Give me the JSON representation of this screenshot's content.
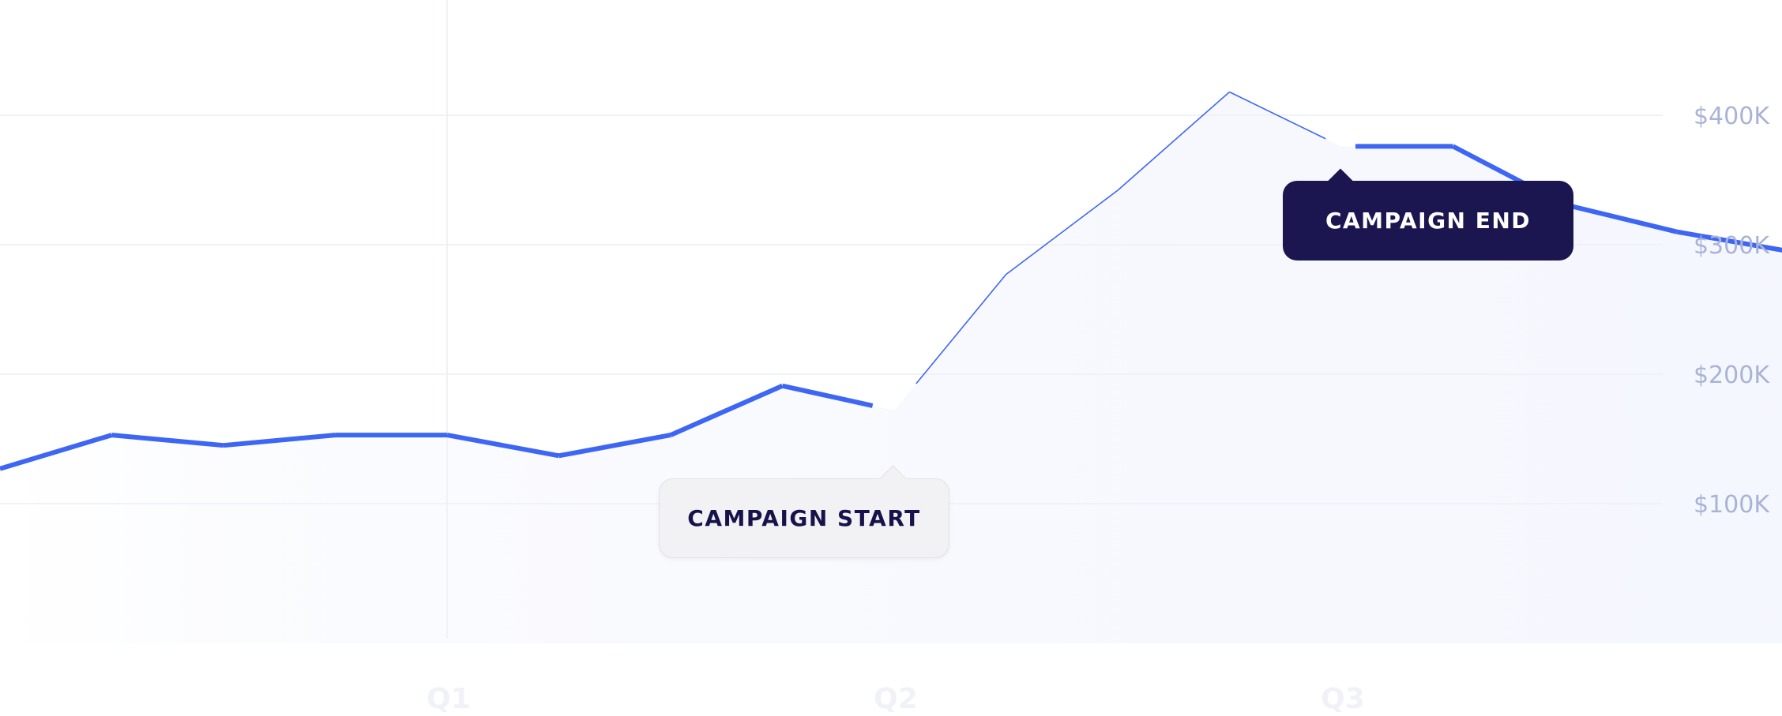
{
  "chart_data": {
    "type": "line",
    "title": "",
    "xlabel": "",
    "ylabel": "",
    "quarters": [
      "Q1",
      "Q2",
      "Q3"
    ],
    "y_ticks": [
      {
        "value": 100000,
        "label": "$100K"
      },
      {
        "value": 200000,
        "label": "$200K"
      },
      {
        "value": 300000,
        "label": "$300K"
      },
      {
        "value": 400000,
        "label": "$400K"
      }
    ],
    "ylim": [
      -4000,
      488000
    ],
    "xlim": [
      0,
      16
    ],
    "series": [
      {
        "color": "#3d66f5",
        "x": [
          0,
          1,
          2,
          3,
          4,
          5,
          6,
          7,
          8,
          9,
          10,
          11,
          12,
          13,
          14,
          15,
          16
        ],
        "values": [
          127000,
          153000,
          145000,
          153000,
          153000,
          137000,
          153000,
          191000,
          172000,
          277000,
          342000,
          418000,
          376000,
          376000,
          331000,
          310000,
          295000
        ]
      }
    ],
    "grid": true,
    "annotations": [
      {
        "label": "CAMPAIGN START",
        "style": "light",
        "x": 8
      },
      {
        "label": "CAMPAIGN END",
        "style": "dark",
        "x": 12
      }
    ],
    "colors": {
      "line": "#3d66f5",
      "area": "#eef1fd",
      "grid": "#eceef5",
      "tick_label": "#aab3d6",
      "quarter_label": "#f1f2f8",
      "callout_dark": "#1b1650",
      "callout_light": "#f2f2f4"
    }
  }
}
